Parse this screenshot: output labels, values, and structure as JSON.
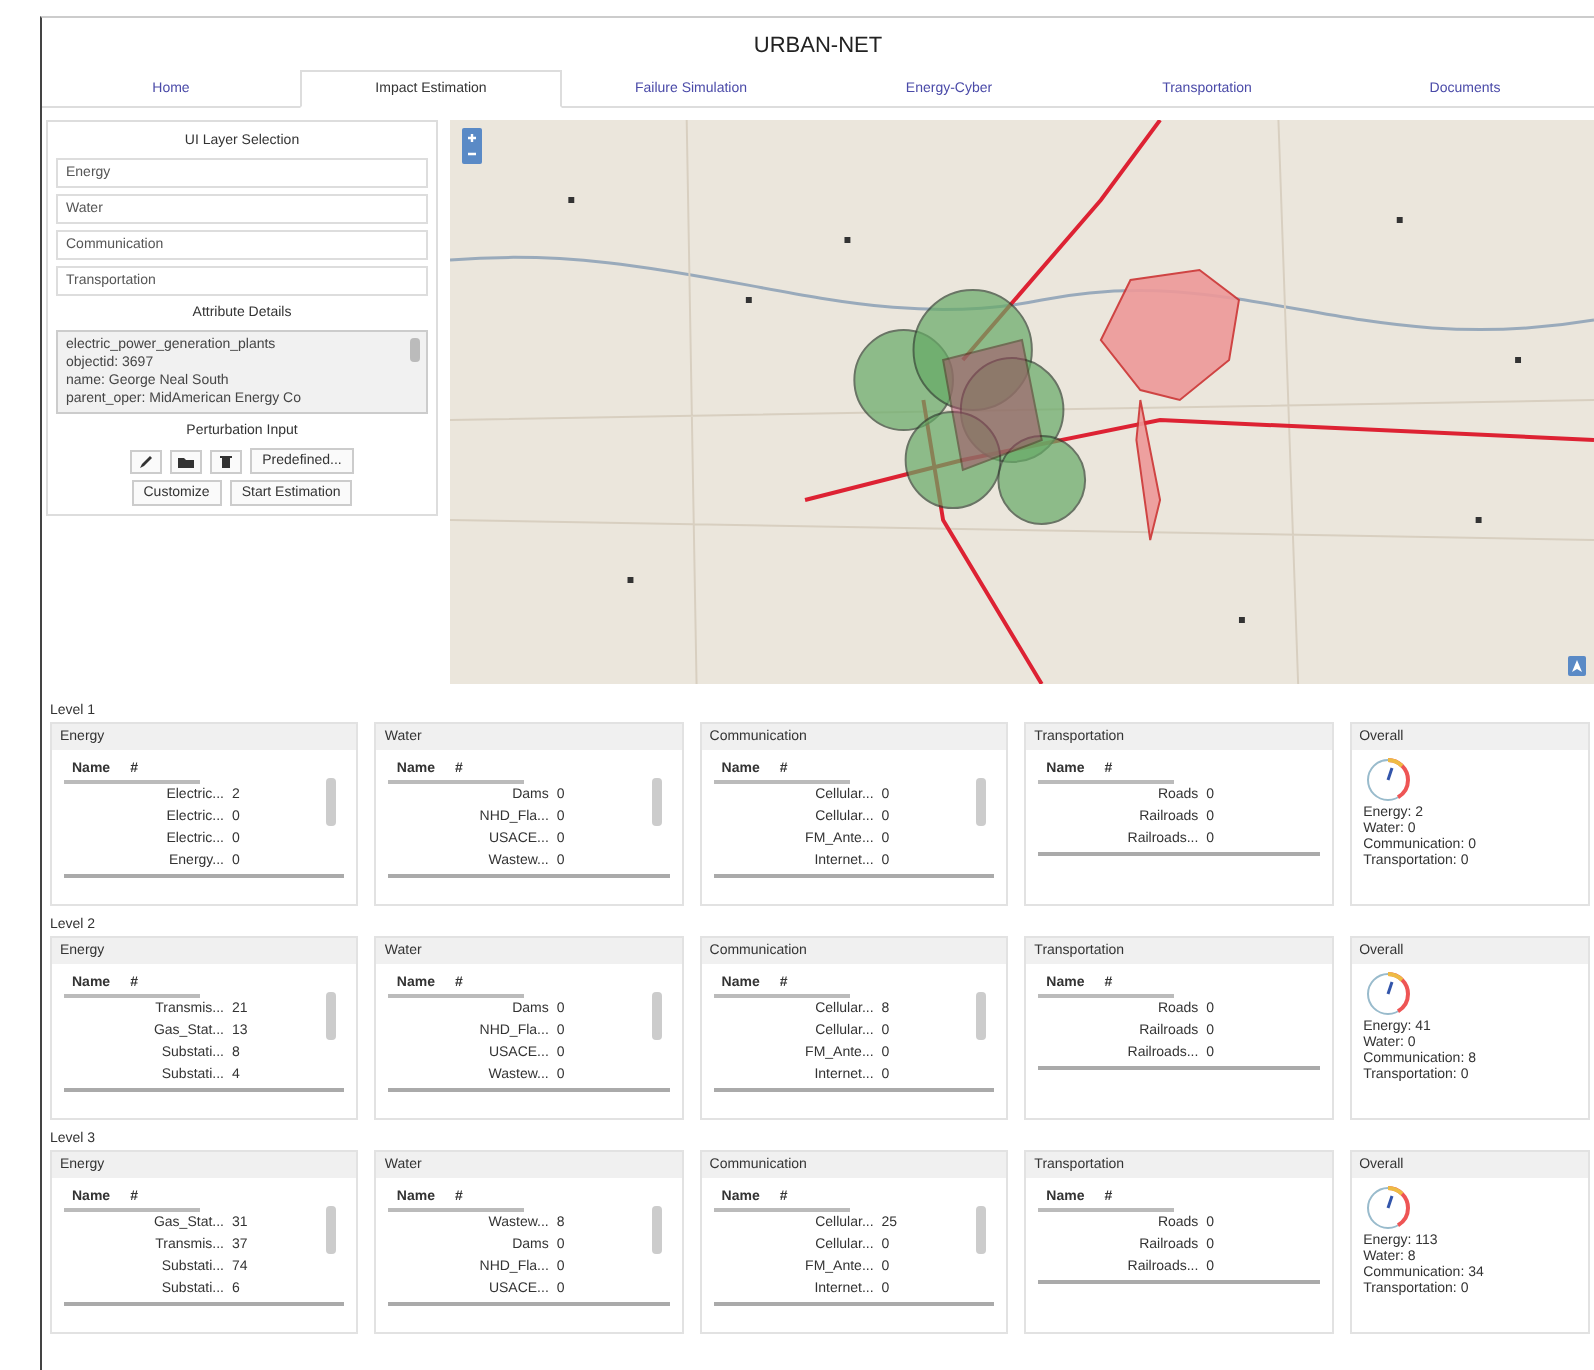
{
  "title": "URBAN-NET",
  "tabs": [
    {
      "label": "Home",
      "selected": false
    },
    {
      "label": "Impact Estimation",
      "selected": true
    },
    {
      "label": "Failure Simulation",
      "selected": false
    },
    {
      "label": "Energy-Cyber",
      "selected": false
    },
    {
      "label": "Transportation",
      "selected": false
    },
    {
      "label": "Documents",
      "selected": false
    }
  ],
  "layer_selection": {
    "title": "UI Layer Selection",
    "layers": [
      "Energy",
      "Water",
      "Communication",
      "Transportation"
    ]
  },
  "attribute_details": {
    "title": "Attribute Details",
    "lines": [
      "electric_power_generation_plants",
      "objectid: 3697",
      "name: George Neal South",
      "parent_oper: MidAmerican Energy Co"
    ]
  },
  "perturbation": {
    "title": "Perturbation Input",
    "predefined_button": "Predefined...",
    "buttons": [
      "Customize",
      "Start Estimation"
    ]
  },
  "levels": [
    {
      "label": "Level 1",
      "panels": [
        {
          "title": "Energy",
          "columns": [
            "Name",
            "#"
          ],
          "scrollable": true,
          "rows": [
            {
              "name": "Electric...",
              "count": "2"
            },
            {
              "name": "Electric...",
              "count": "0"
            },
            {
              "name": "Electric...",
              "count": "0"
            },
            {
              "name": "Energy...",
              "count": "0"
            }
          ]
        },
        {
          "title": "Water",
          "columns": [
            "Name",
            "#"
          ],
          "scrollable": true,
          "rows": [
            {
              "name": "Dams",
              "count": "0"
            },
            {
              "name": "NHD_Fla...",
              "count": "0"
            },
            {
              "name": "USACE...",
              "count": "0"
            },
            {
              "name": "Wastew...",
              "count": "0"
            }
          ]
        },
        {
          "title": "Communication",
          "columns": [
            "Name",
            "#"
          ],
          "scrollable": true,
          "rows": [
            {
              "name": "Cellular...",
              "count": "0"
            },
            {
              "name": "Cellular...",
              "count": "0"
            },
            {
              "name": "FM_Ante...",
              "count": "0"
            },
            {
              "name": "Internet...",
              "count": "0"
            }
          ]
        },
        {
          "title": "Transportation",
          "columns": [
            "Name",
            "#"
          ],
          "scrollable": false,
          "rows": [
            {
              "name": "Roads",
              "count": "0"
            },
            {
              "name": "Railroads",
              "count": "0"
            },
            {
              "name": "Railroads...",
              "count": "0"
            }
          ]
        }
      ],
      "overall": {
        "title": "Overall",
        "lines": [
          "Energy: 2",
          "Water: 0",
          "Communication: 0",
          "Transportation: 0"
        ]
      }
    },
    {
      "label": "Level 2",
      "panels": [
        {
          "title": "Energy",
          "columns": [
            "Name",
            "#"
          ],
          "scrollable": true,
          "rows": [
            {
              "name": "Transmis...",
              "count": "21"
            },
            {
              "name": "Gas_Stat...",
              "count": "13"
            },
            {
              "name": "Substati...",
              "count": "8"
            },
            {
              "name": "Substati...",
              "count": "4"
            }
          ]
        },
        {
          "title": "Water",
          "columns": [
            "Name",
            "#"
          ],
          "scrollable": true,
          "rows": [
            {
              "name": "Dams",
              "count": "0"
            },
            {
              "name": "NHD_Fla...",
              "count": "0"
            },
            {
              "name": "USACE...",
              "count": "0"
            },
            {
              "name": "Wastew...",
              "count": "0"
            }
          ]
        },
        {
          "title": "Communication",
          "columns": [
            "Name",
            "#"
          ],
          "scrollable": true,
          "rows": [
            {
              "name": "Cellular...",
              "count": "8"
            },
            {
              "name": "Cellular...",
              "count": "0"
            },
            {
              "name": "FM_Ante...",
              "count": "0"
            },
            {
              "name": "Internet...",
              "count": "0"
            }
          ]
        },
        {
          "title": "Transportation",
          "columns": [
            "Name",
            "#"
          ],
          "scrollable": false,
          "rows": [
            {
              "name": "Roads",
              "count": "0"
            },
            {
              "name": "Railroads",
              "count": "0"
            },
            {
              "name": "Railroads...",
              "count": "0"
            }
          ]
        }
      ],
      "overall": {
        "title": "Overall",
        "lines": [
          "Energy: 41",
          "Water: 0",
          "Communication: 8",
          "Transportation: 0"
        ]
      }
    },
    {
      "label": "Level 3",
      "panels": [
        {
          "title": "Energy",
          "columns": [
            "Name",
            "#"
          ],
          "scrollable": true,
          "rows": [
            {
              "name": "Gas_Stat...",
              "count": "31"
            },
            {
              "name": "Transmis...",
              "count": "37"
            },
            {
              "name": "Substati...",
              "count": "74"
            },
            {
              "name": "Substati...",
              "count": "6"
            }
          ]
        },
        {
          "title": "Water",
          "columns": [
            "Name",
            "#"
          ],
          "scrollable": true,
          "rows": [
            {
              "name": "Wastew...",
              "count": "8"
            },
            {
              "name": "Dams",
              "count": "0"
            },
            {
              "name": "NHD_Fla...",
              "count": "0"
            },
            {
              "name": "USACE...",
              "count": "0"
            }
          ]
        },
        {
          "title": "Communication",
          "columns": [
            "Name",
            "#"
          ],
          "scrollable": true,
          "rows": [
            {
              "name": "Cellular...",
              "count": "25"
            },
            {
              "name": "Cellular...",
              "count": "0"
            },
            {
              "name": "FM_Ante...",
              "count": "0"
            },
            {
              "name": "Internet...",
              "count": "0"
            }
          ]
        },
        {
          "title": "Transportation",
          "columns": [
            "Name",
            "#"
          ],
          "scrollable": false,
          "rows": [
            {
              "name": "Roads",
              "count": "0"
            },
            {
              "name": "Railroads",
              "count": "0"
            },
            {
              "name": "Railroads...",
              "count": "0"
            }
          ]
        }
      ],
      "overall": {
        "title": "Overall",
        "lines": [
          "Energy: 113",
          "Water: 8",
          "Communication: 34",
          "Transportation: 0"
        ]
      }
    }
  ]
}
